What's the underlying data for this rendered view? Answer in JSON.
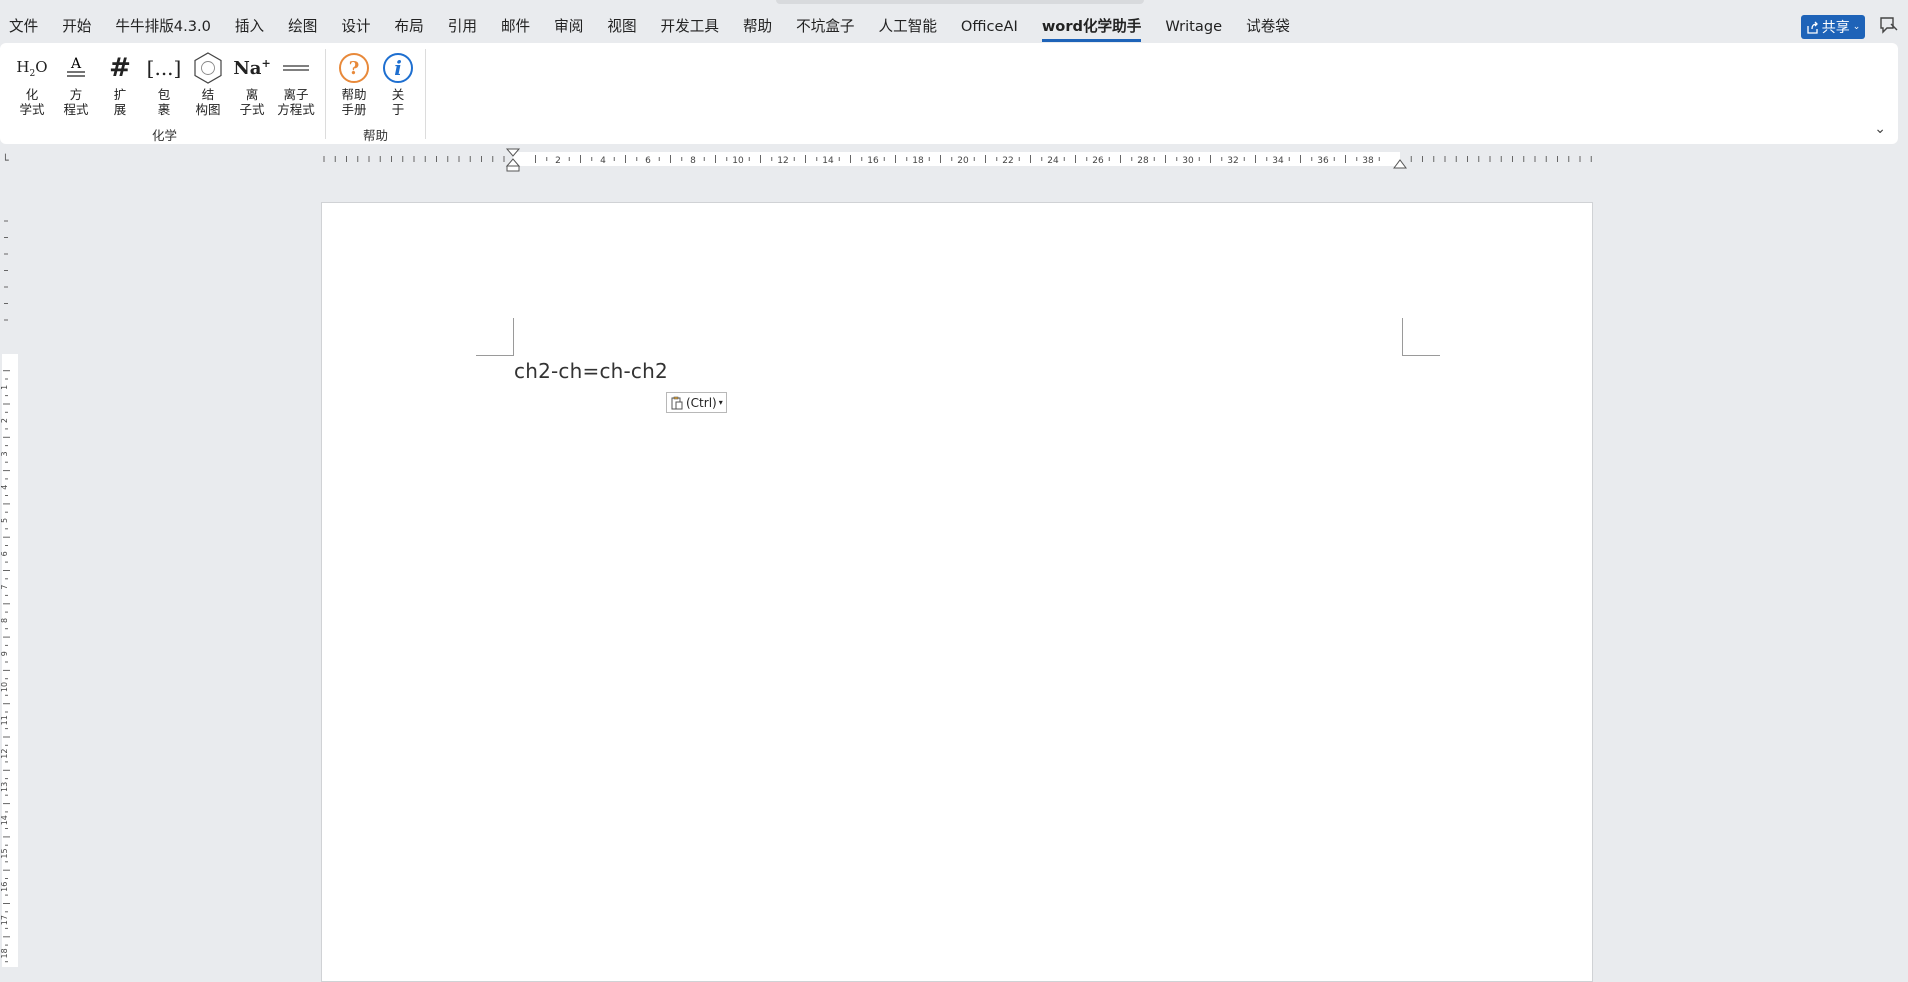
{
  "menu": {
    "tabs": [
      {
        "label": "文件"
      },
      {
        "label": "开始"
      },
      {
        "label": "牛牛排版4.3.0"
      },
      {
        "label": "插入"
      },
      {
        "label": "绘图"
      },
      {
        "label": "设计"
      },
      {
        "label": "布局"
      },
      {
        "label": "引用"
      },
      {
        "label": "邮件"
      },
      {
        "label": "审阅"
      },
      {
        "label": "视图"
      },
      {
        "label": "开发工具"
      },
      {
        "label": "帮助"
      },
      {
        "label": "不坑盒子"
      },
      {
        "label": "人工智能"
      },
      {
        "label": "OfficeAI"
      },
      {
        "label": "word化学助手"
      },
      {
        "label": "Writage"
      },
      {
        "label": "试卷袋"
      }
    ],
    "active_tab": "word化学助手",
    "share_label": "共享",
    "accent_color": "#1e63b8"
  },
  "ribbon": {
    "chem_group": {
      "label": "化学",
      "buttons": [
        {
          "line1": "化",
          "line2": "学式",
          "icon": "chemical-formula-icon",
          "icon_text": "H₂O"
        },
        {
          "line1": "方",
          "line2": "程式",
          "icon": "equation-icon",
          "icon_text": ""
        },
        {
          "line1": "扩",
          "line2": "展",
          "icon": "hash-icon",
          "icon_text": "#"
        },
        {
          "line1": "包",
          "line2": "裹",
          "icon": "bracket-wrap-icon",
          "icon_text": "[...]"
        },
        {
          "line1": "结",
          "line2": "构图",
          "icon": "benzene-structure-icon",
          "icon_text": ""
        },
        {
          "line1": "离",
          "line2": "子式",
          "icon": "ion-formula-icon",
          "icon_text": "Na"
        },
        {
          "line1": "离子",
          "line2": "方程式",
          "icon": "ion-equation-icon",
          "icon_text": ""
        }
      ]
    },
    "help_group": {
      "label": "帮助",
      "buttons": [
        {
          "line1": "帮助",
          "line2": "手册",
          "icon": "help-manual-icon",
          "icon_text": "?"
        },
        {
          "line1": "关",
          "line2": "于",
          "icon": "about-info-icon",
          "icon_text": "i"
        }
      ]
    }
  },
  "ruler": {
    "h_labels": [
      "2",
      "4",
      "6",
      "8",
      "10",
      "12",
      "14",
      "16",
      "18",
      "20",
      "22",
      "24",
      "26",
      "28",
      "30",
      "32",
      "34",
      "36",
      "38"
    ],
    "v_labels": [
      "1",
      "2",
      "3",
      "4",
      "5",
      "6",
      "7",
      "8",
      "9",
      "10",
      "11",
      "12",
      "13",
      "14",
      "15",
      "16",
      "17",
      "18"
    ]
  },
  "document": {
    "text": "ch2-ch=ch-ch2",
    "paste_options_label": "(Ctrl)"
  }
}
